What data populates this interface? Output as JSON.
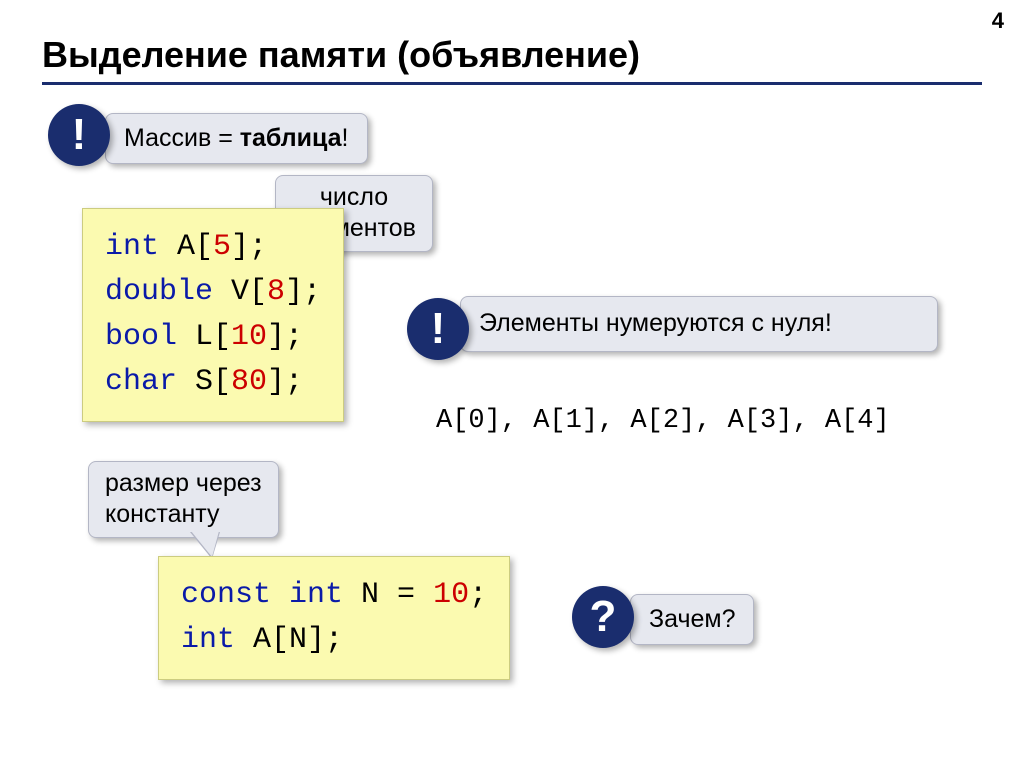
{
  "page_number": "4",
  "title": "Выделение памяти (объявление)",
  "callout_array": {
    "prefix": "Массив = ",
    "bold": "таблица",
    "suffix": "!"
  },
  "callout_count": "число\nэлементов",
  "callout_zero": "Элементы нумеруются с нуля!",
  "callout_const": "размер через\nконстанту",
  "callout_why": "Зачем?",
  "bang1": "!",
  "bang2": "!",
  "qmark": "?",
  "code1": {
    "l1_kw": "int",
    "l1_rest_a": " A[",
    "l1_num": "5",
    "l1_rest_b": "];",
    "l2_kw": "double",
    "l2_rest_a": " V[",
    "l2_num": "8",
    "l2_rest_b": "];",
    "l3_kw": "bool",
    "l3_rest_a": " L[",
    "l3_num": "10",
    "l3_rest_b": "];",
    "l4_kw": "char",
    "l4_rest_a": " S[",
    "l4_num": "80",
    "l4_rest_b": "];"
  },
  "index_line": "A[0], A[1], A[2], A[3], A[4]",
  "code2": {
    "l1_kw1": "const",
    "l1_sp1": " ",
    "l1_kw2": "int",
    "l1_mid": " N = ",
    "l1_num": "10",
    "l1_end": ";",
    "l2_kw": "int",
    "l2_rest": " A[N];"
  }
}
